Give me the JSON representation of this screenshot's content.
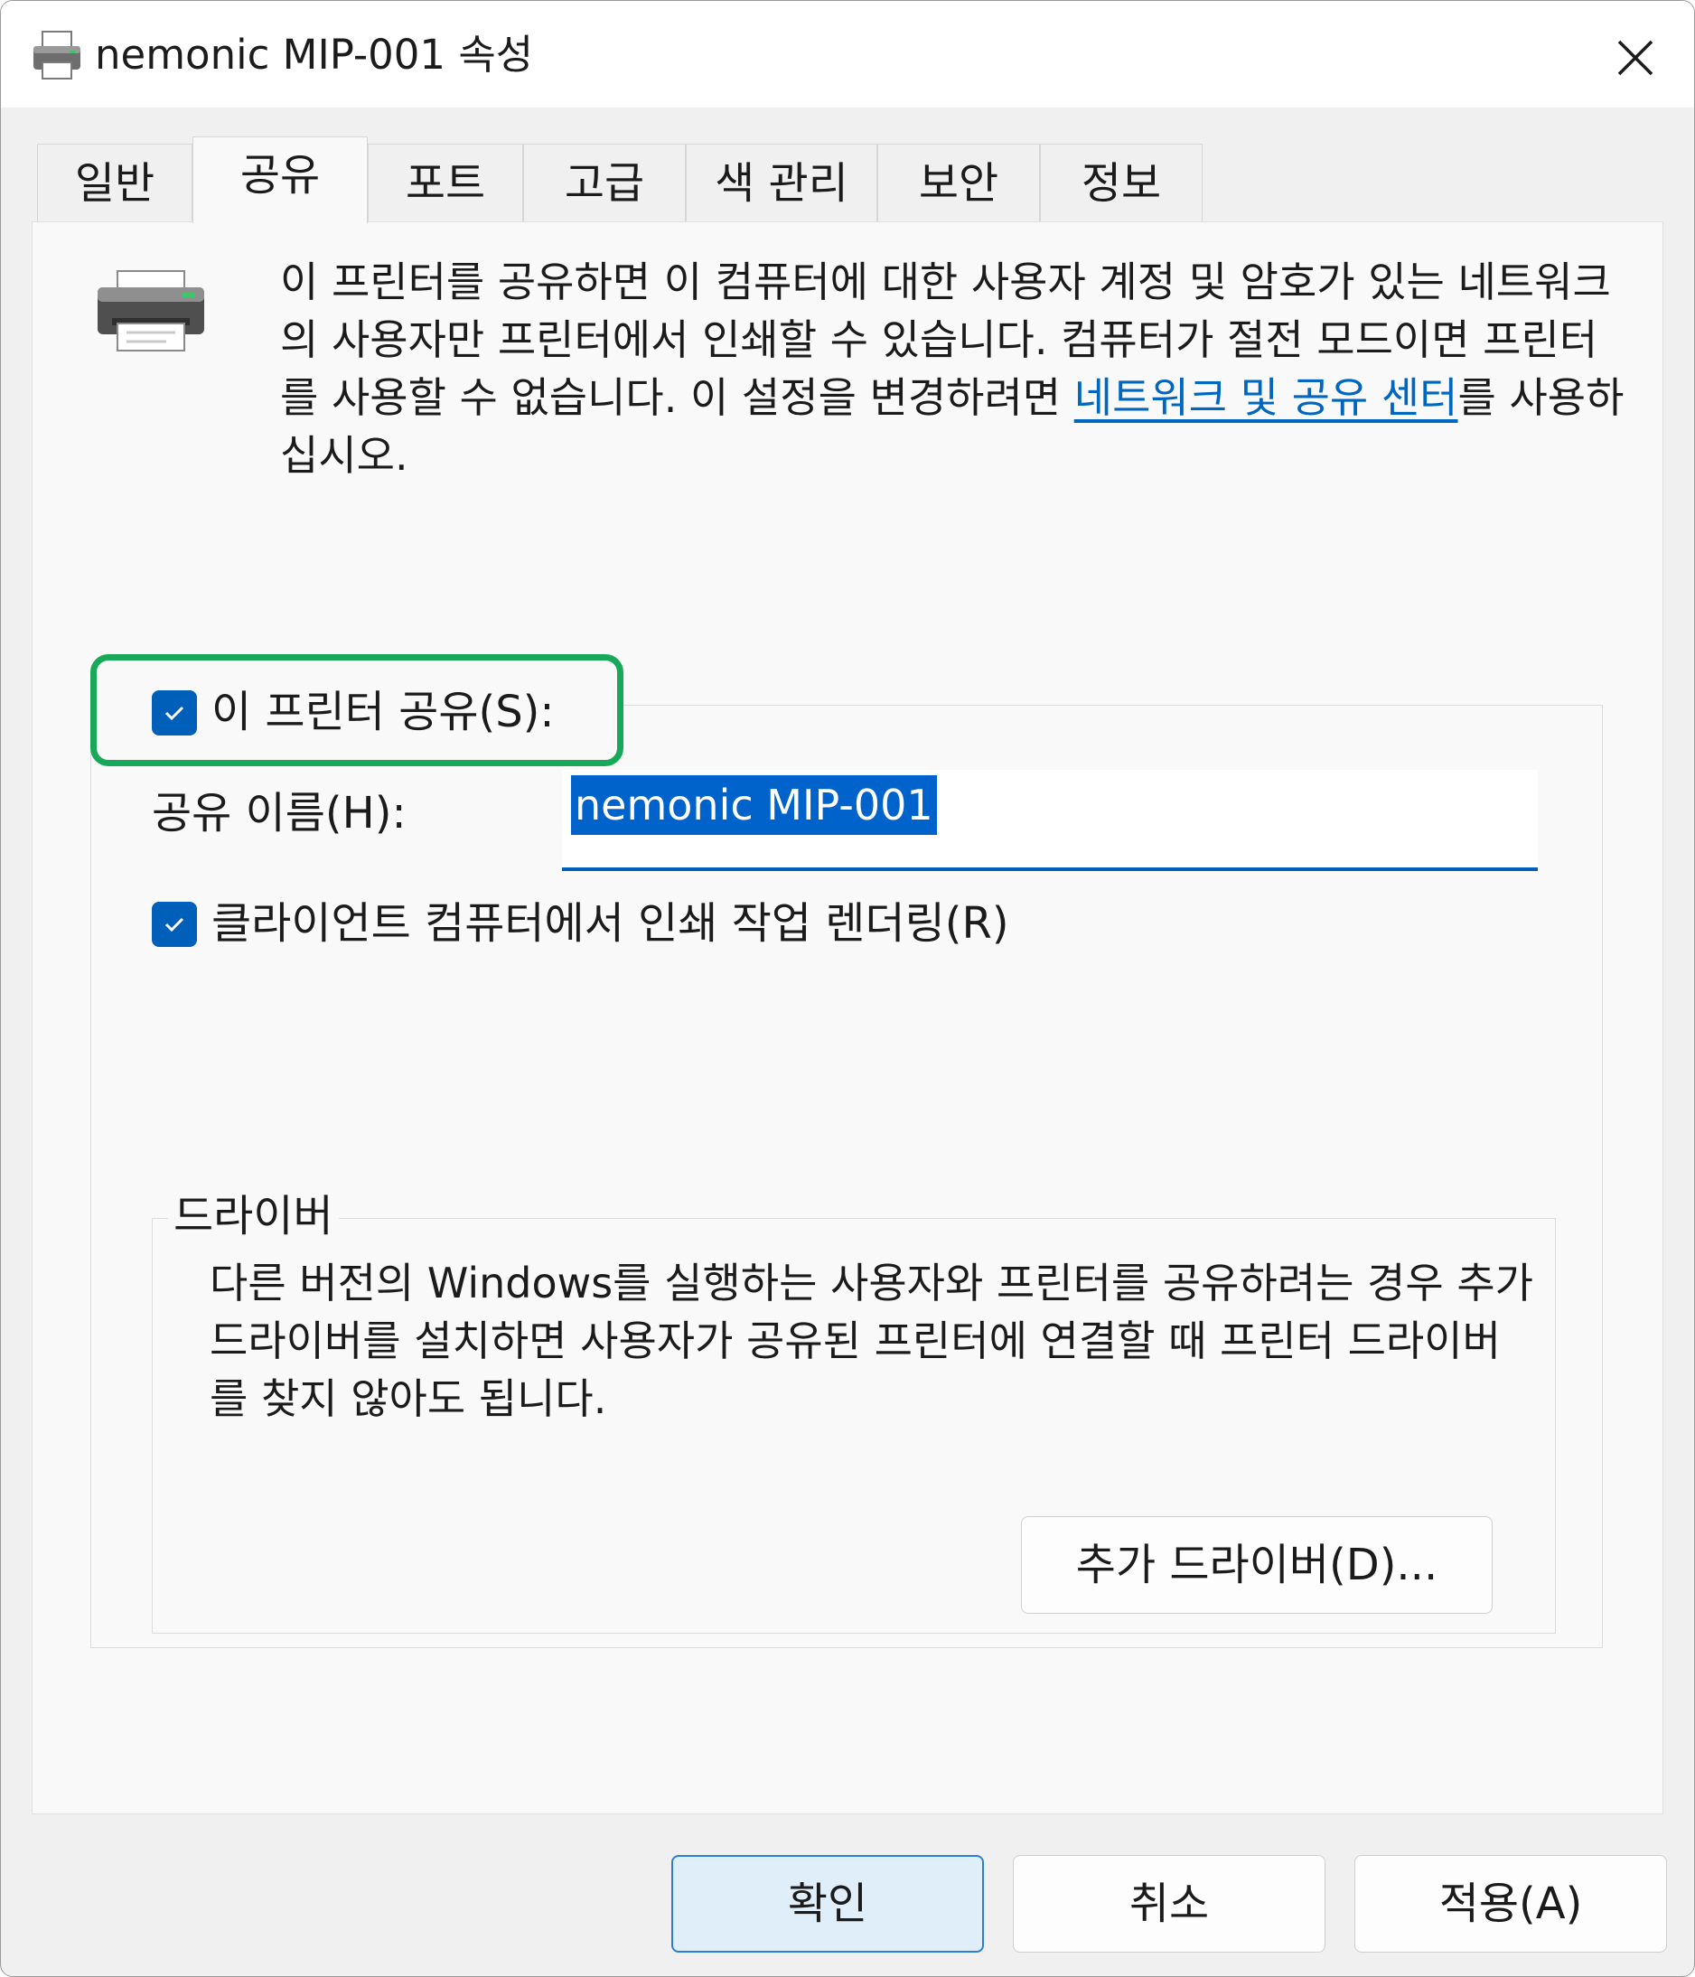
{
  "window": {
    "title": "nemonic MIP-001 속성"
  },
  "tabs": [
    {
      "label": "일반"
    },
    {
      "label": "공유"
    },
    {
      "label": "포트"
    },
    {
      "label": "고급"
    },
    {
      "label": "색 관리"
    },
    {
      "label": "보안"
    },
    {
      "label": "정보"
    }
  ],
  "active_tab": "공유",
  "intro": {
    "text": "이 프린터를 공유하면 이 컴퓨터에 대한 사용자 계정 및 암호가 있는 네트워크의 사용자만 프린터에서 인쇄할 수 있습니다. 컴퓨터가 절전 모드이면 프린터를 사용할 수 없습니다. 이 설정을 변경하려면 ",
    "link": "네트워크 및 공유 센터",
    "suffix": "를 사용하십시오."
  },
  "share": {
    "checkbox_label": "이 프린터 공유(S):",
    "checked": true,
    "name_label": "공유 이름(H):",
    "name_value": "nemonic MIP-001",
    "render_label": "클라이언트 컴퓨터에서 인쇄 작업 렌더링(R)",
    "render_checked": true
  },
  "drivers": {
    "legend": "드라이버",
    "description": "다른 버전의 Windows를 실행하는 사용자와 프린터를 공유하려는 경우 추가 드라이버를 설치하면 사용자가 공유된 프린터에 연결할 때 프린터 드라이버를 찾지 않아도 됩니다.",
    "button": "추가 드라이버(D)..."
  },
  "footer": {
    "ok": "확인",
    "cancel": "취소",
    "apply": "적용(A)"
  },
  "colors": {
    "accent": "#005fb8",
    "link": "#0067c0",
    "highlight": "#17a85a"
  },
  "icons": [
    "printer-icon",
    "close-icon",
    "checkmark-icon"
  ]
}
